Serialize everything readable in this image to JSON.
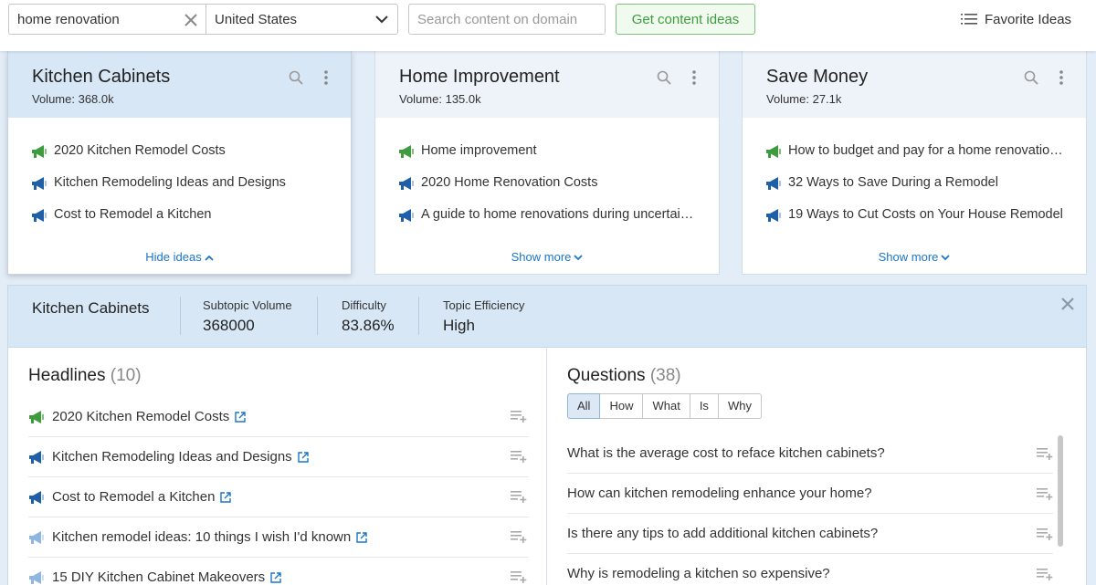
{
  "search": {
    "keyword": "home renovation",
    "country": "United States",
    "domain_placeholder": "Search content on domain",
    "get_ideas_label": "Get content ideas",
    "favorite_label": "Favorite Ideas"
  },
  "cards": [
    {
      "title": "Kitchen Cabinets",
      "volume": "Volume:  368.0k",
      "items": [
        {
          "text": "2020 Kitchen Remodel Costs",
          "icon": "green-megaphone-icon"
        },
        {
          "text": "Kitchen Remodeling Ideas and Designs",
          "icon": "blue-megaphone-icon"
        },
        {
          "text": "Cost to Remodel a Kitchen",
          "icon": "blue-megaphone-icon"
        }
      ],
      "footer": "Hide ideas"
    },
    {
      "title": "Home Improvement",
      "volume": "Volume:  135.0k",
      "items": [
        {
          "text": "Home improvement",
          "icon": "green-megaphone-icon"
        },
        {
          "text": "2020 Home Renovation Costs",
          "icon": "blue-megaphone-icon"
        },
        {
          "text": "A guide to home renovations during uncertai…",
          "icon": "blue-megaphone-icon"
        }
      ],
      "footer": "Show more"
    },
    {
      "title": "Save Money",
      "volume": "Volume:  27.1k",
      "items": [
        {
          "text": "How to budget and pay for a home renovatio…",
          "icon": "green-megaphone-icon"
        },
        {
          "text": "32 Ways to Save During a Remodel",
          "icon": "blue-megaphone-icon"
        },
        {
          "text": "19 Ways to Cut Costs on Your House Remodel",
          "icon": "blue-megaphone-icon"
        }
      ],
      "footer": "Show more"
    }
  ],
  "detail": {
    "topic": "Kitchen Cabinets",
    "subtopic_volume_label": "Subtopic Volume",
    "subtopic_volume": "368000",
    "difficulty_label": "Difficulty",
    "difficulty": "83.86%",
    "efficiency_label": "Topic Efficiency",
    "efficiency": "High"
  },
  "headlines": {
    "title": "Headlines",
    "count": "(10)",
    "items": [
      {
        "text": "2020 Kitchen Remodel Costs",
        "icon": "green-megaphone-icon"
      },
      {
        "text": "Kitchen Remodeling Ideas and Designs",
        "icon": "blue-megaphone-icon"
      },
      {
        "text": "Cost to Remodel a Kitchen",
        "icon": "blue-megaphone-icon"
      },
      {
        "text": "Kitchen remodel ideas: 10 things I wish I'd known",
        "icon": "light-blue-megaphone-icon"
      },
      {
        "text": "15 DIY Kitchen Cabinet Makeovers",
        "icon": "light-blue-megaphone-icon"
      }
    ]
  },
  "questions": {
    "title": "Questions",
    "count": "(38)",
    "filters": [
      "All",
      "How",
      "What",
      "Is",
      "Why"
    ],
    "selected_filter": "All",
    "items": [
      "What is the average cost to reface kitchen cabinets?",
      "How can kitchen remodeling enhance your home?",
      "Is there any tips to add additional kitchen cabinets?",
      "Why is remodeling a kitchen so expensive?"
    ]
  },
  "colors": {
    "accent_blue": "#1a76c9",
    "green": "#3e9c3e",
    "active_header": "#d7e7f6"
  }
}
